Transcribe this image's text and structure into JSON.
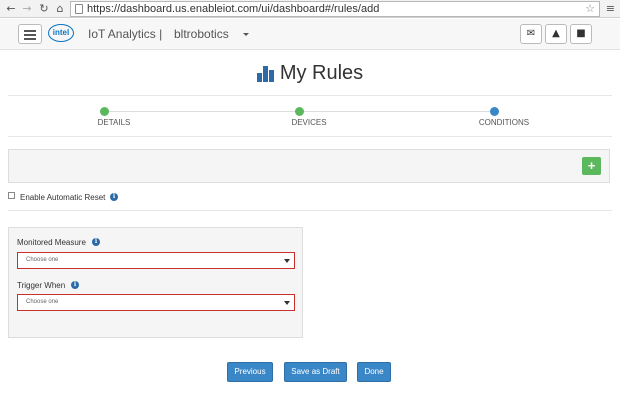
{
  "browser": {
    "url": "https://dashboard.us.enableiot.com/ui/dashboard#/rules/add",
    "back_icon": "back-arrow-icon",
    "forward_icon": "forward-arrow-icon",
    "reload_icon": "reload-icon",
    "home_icon": "home-icon"
  },
  "header": {
    "logo_text": "intel",
    "app_title": "IoT Analytics |",
    "account_name": "bltrobotics"
  },
  "page": {
    "title": "My Rules"
  },
  "steps": [
    {
      "label": "DETAILS",
      "status": "complete",
      "color": "#5cb85c"
    },
    {
      "label": "DEVICES",
      "status": "complete",
      "color": "#5cb85c"
    },
    {
      "label": "CONDITIONS",
      "status": "current",
      "color": "#3a87c8"
    }
  ],
  "conditions": {
    "add_label": "+"
  },
  "reset": {
    "label": "Enable Automatic Reset",
    "checked": false
  },
  "form": {
    "monitored_measure": {
      "label": "Monitored Measure",
      "value": "Choose one"
    },
    "trigger_when": {
      "label": "Trigger When",
      "value": "Choose one"
    }
  },
  "actions": {
    "previous": "Previous",
    "save_draft": "Save as Draft",
    "done": "Done"
  },
  "colors": {
    "primary": "#3a87c8",
    "success": "#5cb85c",
    "error_border": "#c9302c"
  }
}
